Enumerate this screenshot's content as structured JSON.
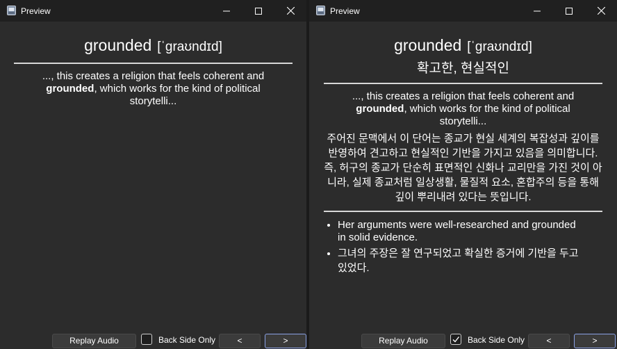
{
  "windows": [
    {
      "title": "Preview",
      "word": "grounded",
      "ipa": "[ˈɡraʊndɪd]",
      "meaning": "",
      "example_prefix": "..., this creates a religion that feels coherent and ",
      "example_bold": "grounded",
      "example_suffix": ", which works for the kind of political storytelli...",
      "explanation": "",
      "examples": [],
      "replay_label": "Replay Audio",
      "back_side_label": "Back Side Only",
      "back_side_checked": false,
      "prev_label": "<",
      "next_label": ">"
    },
    {
      "title": "Preview",
      "word": "grounded",
      "ipa": "[ˈɡraʊndɪd]",
      "meaning": "확고한, 현실적인",
      "example_prefix": "..., this creates a religion that feels coherent and ",
      "example_bold": "grounded",
      "example_suffix": ", which works for the kind of political storytelli...",
      "explanation": "주어진 문맥에서 이 단어는 종교가 현실 세계의 복잡성과 깊이를 반영하여 견고하고 현실적인 기반을 가지고 있음을 의미합니다. 즉, 허구의 종교가 단순히 표면적인 신화나 교리만을 가진 것이 아니라, 실제 종교처럼 일상생활, 물질적 요소, 혼합주의 등을 통해 깊이 뿌리내려 있다는 뜻입니다.",
      "examples": [
        "Her arguments were well-researched and grounded in solid evidence.",
        "그녀의 주장은 잘 연구되었고 확실한 증거에 기반을 두고 있었다."
      ],
      "replay_label": "Replay Audio",
      "back_side_label": "Back Side Only",
      "back_side_checked": true,
      "prev_label": "<",
      "next_label": ">"
    }
  ],
  "icons": {
    "app": "app-icon",
    "minimize": "minimize-icon",
    "maximize": "maximize-icon",
    "close": "close-icon",
    "checkmark": "checkmark-icon"
  },
  "colors": {
    "window_bg": "#2c2c2c",
    "titlebar_bg": "#202020",
    "button_bg": "#3b3b3b",
    "focus_border": "#8aa2e6",
    "separator": "#d8d8d8"
  }
}
